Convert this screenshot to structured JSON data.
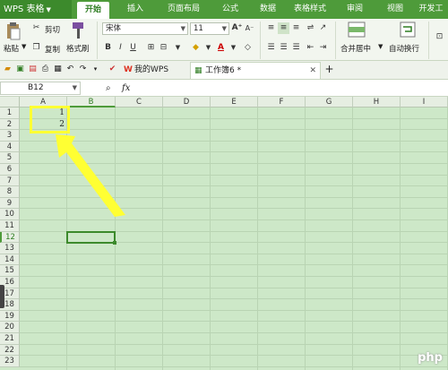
{
  "app": {
    "name": "WPS 表格"
  },
  "ribbon_tabs": [
    {
      "label": "开始",
      "active": true
    },
    {
      "label": "插入"
    },
    {
      "label": "页面布局"
    },
    {
      "label": "公式"
    },
    {
      "label": "数据"
    },
    {
      "label": "表格样式"
    },
    {
      "label": "审阅"
    },
    {
      "label": "视图"
    },
    {
      "label": "开发工"
    }
  ],
  "ribbon": {
    "paste": "粘贴",
    "cut": "剪切",
    "copy": "复制",
    "format_painter": "格式刷",
    "font_name": "宋体",
    "font_size": "11",
    "merge_center": "合并居中",
    "auto_wrap": "自动换行"
  },
  "doc_tabs": [
    {
      "label": "我的WPS"
    },
    {
      "label": "工作簿6 *",
      "active": true
    }
  ],
  "formula_bar": {
    "name_box": "B12",
    "fx": "fx",
    "value": ""
  },
  "columns": [
    "A",
    "B",
    "C",
    "D",
    "E",
    "F",
    "G",
    "H",
    "I"
  ],
  "rows": [
    "1",
    "2",
    "3",
    "4",
    "5",
    "6",
    "7",
    "8",
    "9",
    "10",
    "11",
    "12",
    "13",
    "14",
    "15",
    "16",
    "17",
    "18",
    "19",
    "20",
    "21",
    "22",
    "23"
  ],
  "cells": {
    "A1": "1",
    "A2": "2"
  },
  "watermark": "php",
  "colors": {
    "brand_green": "#4e9b3a",
    "grid_bg": "#cde8c8",
    "annotation_yellow": "#ffff33"
  }
}
